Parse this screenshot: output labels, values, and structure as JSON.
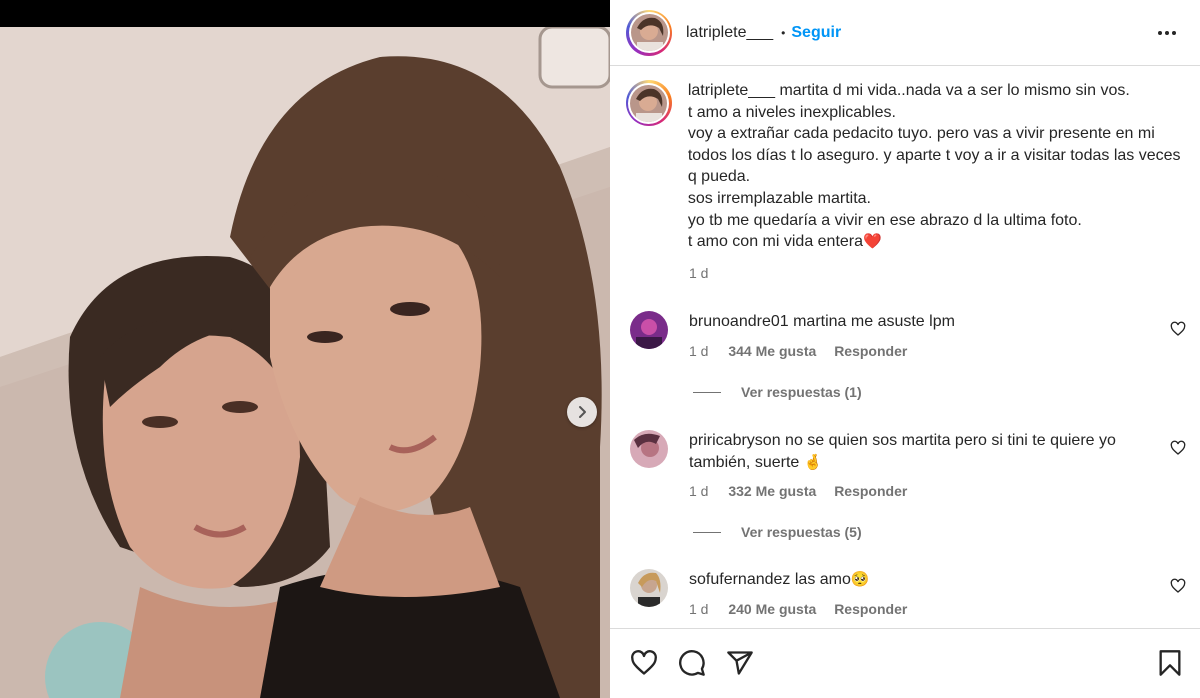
{
  "header": {
    "username": "latriplete___",
    "separator": "•",
    "follow_label": "Seguir",
    "more_icon": "more-horizontal-icon"
  },
  "caption": {
    "username": "latriplete___",
    "lines": [
      " martita d mi vida..nada va a ser lo mismo sin vos.",
      "t amo a niveles inexplicables.",
      "voy a extrañar cada pedacito tuyo. pero vas a vivir presente en mi todos los días t lo aseguro. y aparte t voy a ir a visitar todas las veces q pueda.",
      "sos irremplazable martita.",
      "yo tb me quedaría a vivir en ese abrazo d la ultima foto.",
      "t amo con mi vida entera"
    ],
    "emoji": "❤️",
    "time": "1 d"
  },
  "comments": [
    {
      "username": "brunoandre01",
      "text": "martina me asuste lpm",
      "emoji": "",
      "time": "1 d",
      "likes": "344 Me gusta",
      "reply_label": "Responder",
      "view_replies": "Ver respuestas (1)"
    },
    {
      "username": "priricabryson",
      "text": "no se quien sos martita pero si tini te quiere yo también, suerte",
      "emoji": "🤞",
      "time": "1 d",
      "likes": "332 Me gusta",
      "reply_label": "Responder",
      "view_replies": "Ver respuestas (5)"
    },
    {
      "username": "sofufernandez",
      "text": "las amo",
      "emoji": "🥺",
      "time": "1 d",
      "likes": "240 Me gusta",
      "reply_label": "Responder"
    }
  ],
  "carousel": {
    "next_icon": "chevron-right-icon"
  },
  "actions": [
    "heart-icon",
    "comment-icon",
    "share-icon",
    "bookmark-icon"
  ],
  "colors": {
    "accent": "#0095f6",
    "muted": "#737373",
    "border": "#dbdbdb"
  }
}
